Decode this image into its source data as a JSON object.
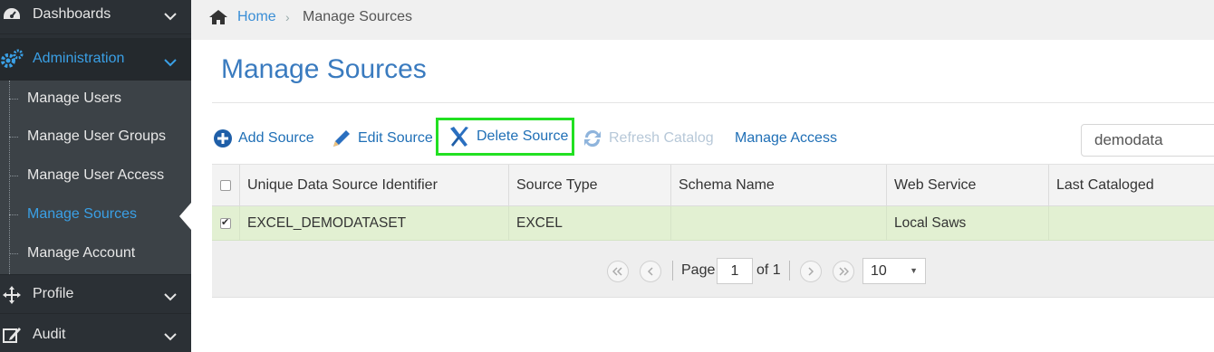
{
  "sidebar": {
    "dashboards_label": "Dashboards",
    "administration_label": "Administration",
    "submenu": [
      "Manage Users",
      "Manage User Groups",
      "Manage User Access",
      "Manage Sources",
      "Manage Account"
    ],
    "active_item": "Manage Sources",
    "profile_label": "Profile",
    "audit_label": "Audit",
    "active_color": "#3aa0e6",
    "icons": [
      "dashboard-icon",
      "gears-icon",
      "move-icon",
      "edit-icon",
      "chevron-down-icon"
    ]
  },
  "breadcrumb": {
    "home": "Home",
    "separator": "›",
    "current": "Manage Sources"
  },
  "page": {
    "title": "Manage Sources"
  },
  "toolbar": {
    "add": "Add Source",
    "edit": "Edit Source",
    "delete": "Delete Source",
    "refresh": "Refresh Catalog",
    "access": "Manage Access",
    "search_value": "demodata",
    "highlight_color": "#22e022"
  },
  "table": {
    "columns": [
      "Unique Data Source Identifier",
      "Source Type",
      "Schema Name",
      "Web Service",
      "Last Cataloged"
    ],
    "rows": [
      {
        "checked": true,
        "cells": [
          "EXCEL_DEMODATASET",
          "EXCEL",
          "",
          "Local Saws",
          ""
        ]
      }
    ],
    "selected_row_color": "#e2f0d2"
  },
  "pager": {
    "page_label": "Page",
    "current_page": "1",
    "of_label": "of 1",
    "page_size": "10"
  }
}
